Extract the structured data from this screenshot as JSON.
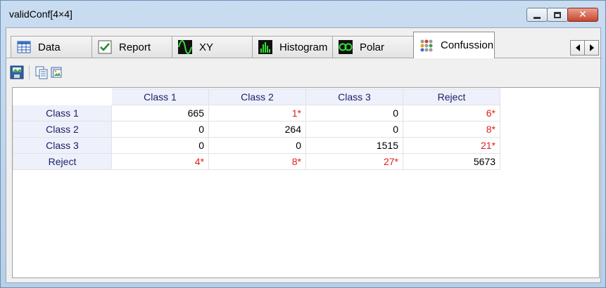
{
  "window": {
    "title": "validConf[4×4]",
    "minimize_icon": "minimize-icon",
    "maximize_icon": "maximize-icon",
    "close_icon": "close-icon"
  },
  "tabs": [
    {
      "label": "Data",
      "icon": "data-grid-icon",
      "active": false
    },
    {
      "label": "Report",
      "icon": "checkmark-icon",
      "active": false
    },
    {
      "label": "XY",
      "icon": "xy-wave-icon",
      "active": false
    },
    {
      "label": "Histogram",
      "icon": "histogram-icon",
      "active": false
    },
    {
      "label": "Polar",
      "icon": "polar-icon",
      "active": false
    },
    {
      "label": "Confussion",
      "icon": "dots-matrix-icon",
      "active": true
    }
  ],
  "tab_scroll": {
    "left_icon": "arrow-left-icon",
    "right_icon": "arrow-right-icon"
  },
  "toolbar": {
    "buttons": [
      "save-image-icon",
      "copy-icon",
      "export-image-icon"
    ]
  },
  "colors": {
    "header_bg": "#eef0fb",
    "header_text": "#1a1f66",
    "error_text": "#e0201a"
  },
  "table": {
    "columns": [
      "Class 1",
      "Class 2",
      "Class 3",
      "Reject"
    ],
    "rows": [
      {
        "label": "Class 1",
        "cells": [
          {
            "v": "665",
            "err": false
          },
          {
            "v": "1*",
            "err": true
          },
          {
            "v": "0",
            "err": false
          },
          {
            "v": "6*",
            "err": true
          }
        ]
      },
      {
        "label": "Class 2",
        "cells": [
          {
            "v": "0",
            "err": false
          },
          {
            "v": "264",
            "err": false
          },
          {
            "v": "0",
            "err": false
          },
          {
            "v": "8*",
            "err": true
          }
        ]
      },
      {
        "label": "Class 3",
        "cells": [
          {
            "v": "0",
            "err": false
          },
          {
            "v": "0",
            "err": false
          },
          {
            "v": "1515",
            "err": false
          },
          {
            "v": "21*",
            "err": true
          }
        ]
      },
      {
        "label": "Reject",
        "cells": [
          {
            "v": "4*",
            "err": true
          },
          {
            "v": "8*",
            "err": true
          },
          {
            "v": "27*",
            "err": true
          },
          {
            "v": "5673",
            "err": false
          }
        ]
      }
    ]
  }
}
